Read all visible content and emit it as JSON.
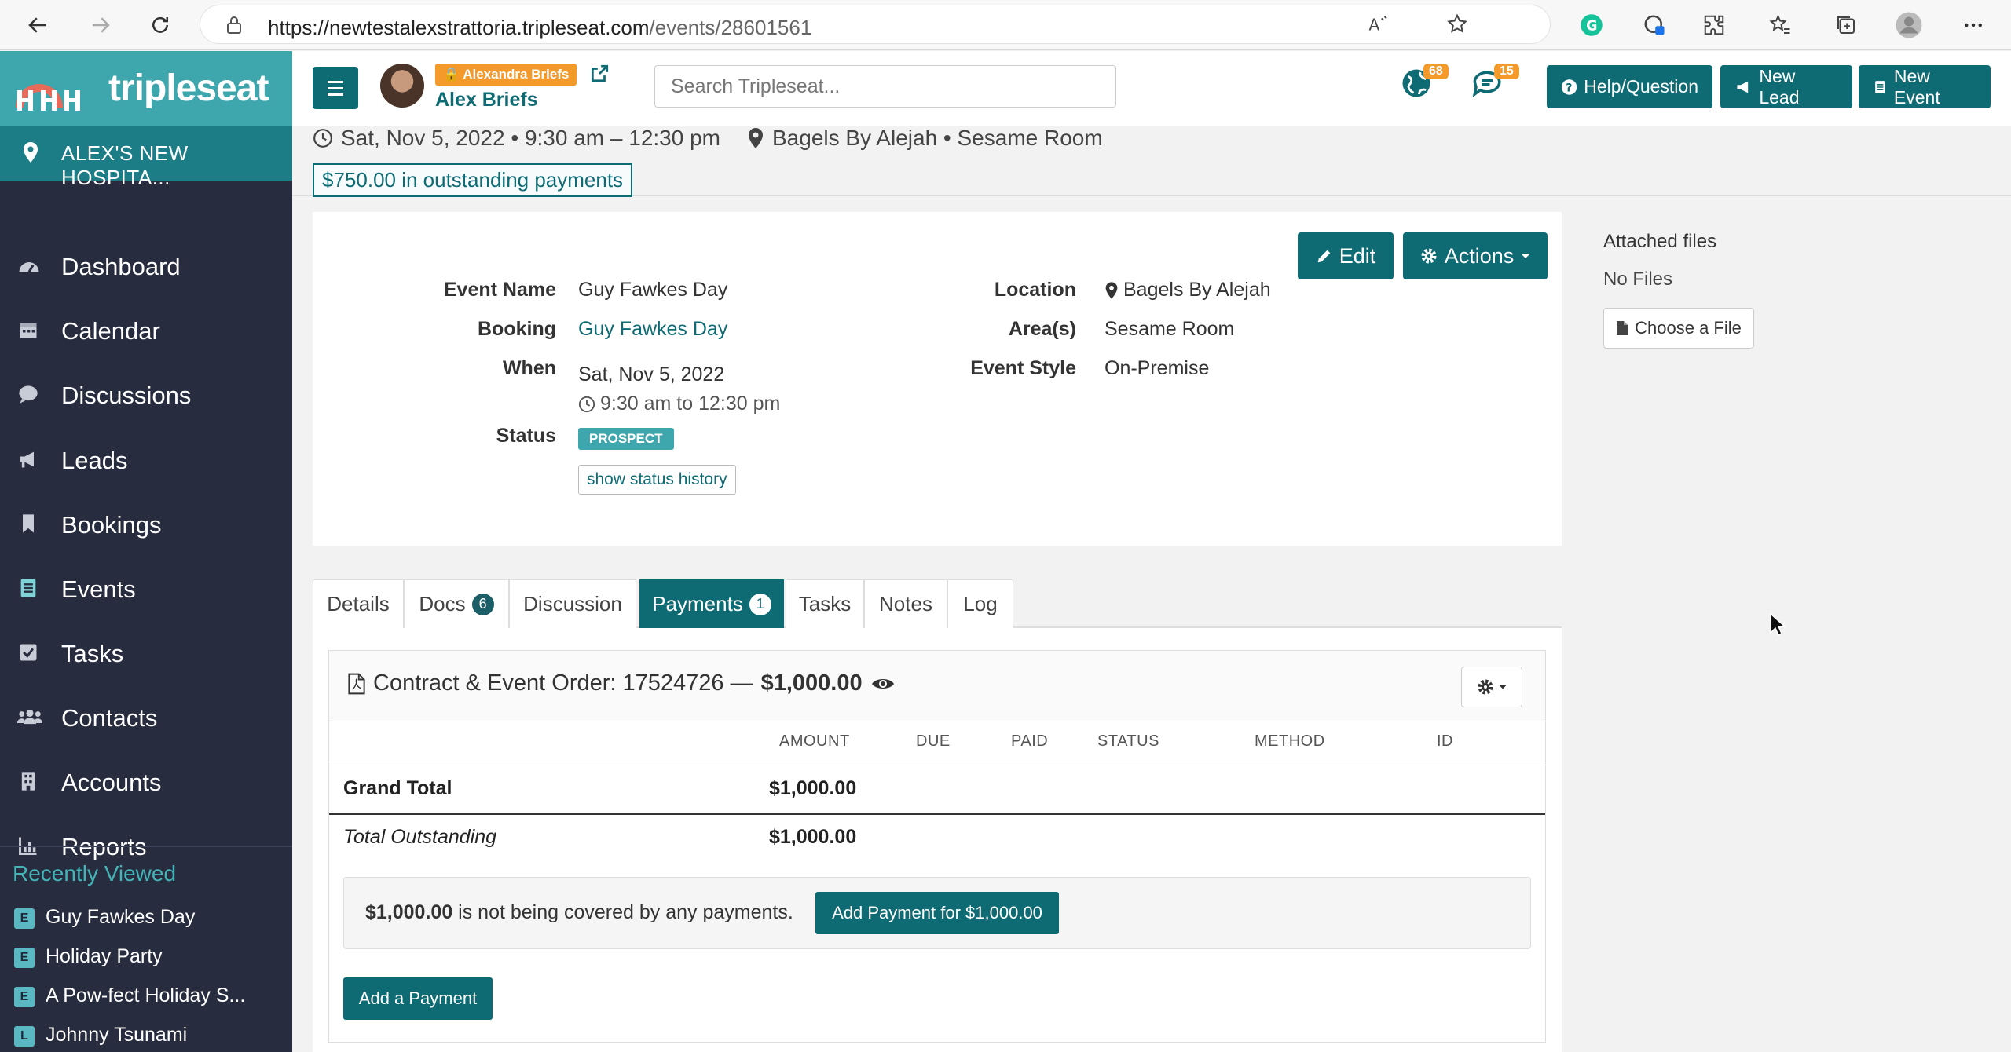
{
  "browser": {
    "url_host": "https://newtestalexstrattoria.tripleseat.com",
    "url_path": "/events/28601561"
  },
  "sidebar": {
    "logo_text": "tripleseat",
    "venue": "ALEX'S NEW HOSPITA...",
    "items": [
      {
        "label": "Dashboard",
        "icon": "dashboard-icon"
      },
      {
        "label": "Calendar",
        "icon": "calendar-icon"
      },
      {
        "label": "Discussions",
        "icon": "chat-icon"
      },
      {
        "label": "Leads",
        "icon": "megaphone-icon"
      },
      {
        "label": "Bookings",
        "icon": "bookmark-icon"
      },
      {
        "label": "Events",
        "icon": "document-icon"
      },
      {
        "label": "Tasks",
        "icon": "checkbox-icon"
      },
      {
        "label": "Contacts",
        "icon": "people-icon"
      },
      {
        "label": "Accounts",
        "icon": "building-icon"
      },
      {
        "label": "Reports",
        "icon": "bar-chart-icon"
      }
    ],
    "recent_title": "Recently Viewed",
    "recent": [
      {
        "badge": "E",
        "label": "Guy Fawkes Day"
      },
      {
        "badge": "E",
        "label": "Holiday Party"
      },
      {
        "badge": "E",
        "label": "A Pow-fect Holiday S..."
      },
      {
        "badge": "L",
        "label": "Johnny Tsunami"
      }
    ]
  },
  "header": {
    "user_badge": "Alexandra Briefs",
    "user_name": "Alex Briefs",
    "search_placeholder": "Search Tripleseat...",
    "notif_globe_count": "68",
    "notif_chat_count": "15",
    "help_label": "Help/Question",
    "new_lead_label": "New Lead",
    "new_event_label": "New Event"
  },
  "event_strip": {
    "datetime": "Sat, Nov 5, 2022 • 9:30 am – 12:30 pm",
    "location": "Bagels By Alejah • Sesame Room",
    "outstanding": "$750.00 in outstanding payments"
  },
  "details": {
    "edit_label": "Edit",
    "actions_label": "Actions",
    "event_name_label": "Event Name",
    "event_name": "Guy Fawkes Day",
    "booking_label": "Booking",
    "booking": "Guy Fawkes Day",
    "when_label": "When",
    "when_date": "Sat, Nov 5, 2022",
    "when_time": "9:30 am to 12:30 pm",
    "status_label": "Status",
    "status": "PROSPECT",
    "status_history": "show status history",
    "location_label": "Location",
    "location": "Bagels By Alejah",
    "areas_label": "Area(s)",
    "areas": "Sesame Room",
    "style_label": "Event Style",
    "style": "On-Premise"
  },
  "attachments": {
    "title": "Attached files",
    "empty": "No Files",
    "choose_label": "Choose a File"
  },
  "tabs": [
    {
      "label": "Details"
    },
    {
      "label": "Docs",
      "count": "6"
    },
    {
      "label": "Discussion"
    },
    {
      "label": "Payments",
      "count": "1",
      "active": true
    },
    {
      "label": "Tasks"
    },
    {
      "label": "Notes"
    },
    {
      "label": "Log"
    }
  ],
  "payments": {
    "title_prefix": "Contract & Event Order: 17524726 —",
    "title_amount": "$1,000.00",
    "columns": [
      "AMOUNT",
      "DUE",
      "PAID",
      "STATUS",
      "METHOD",
      "ID"
    ],
    "grand_total_label": "Grand Total",
    "grand_total": "$1,000.00",
    "outstanding_label": "Total Outstanding",
    "outstanding": "$1,000.00",
    "notice_amount": "$1,000.00",
    "notice_text": "is not being covered by any payments.",
    "notice_button": "Add Payment for $1,000.00",
    "add_payment": "Add a Payment"
  },
  "colors": {
    "brand_teal": "#0e6b73",
    "logo_teal": "#3ea7ad",
    "sidebar_bg": "#272c3f",
    "badge_orange": "#f39a2a"
  }
}
